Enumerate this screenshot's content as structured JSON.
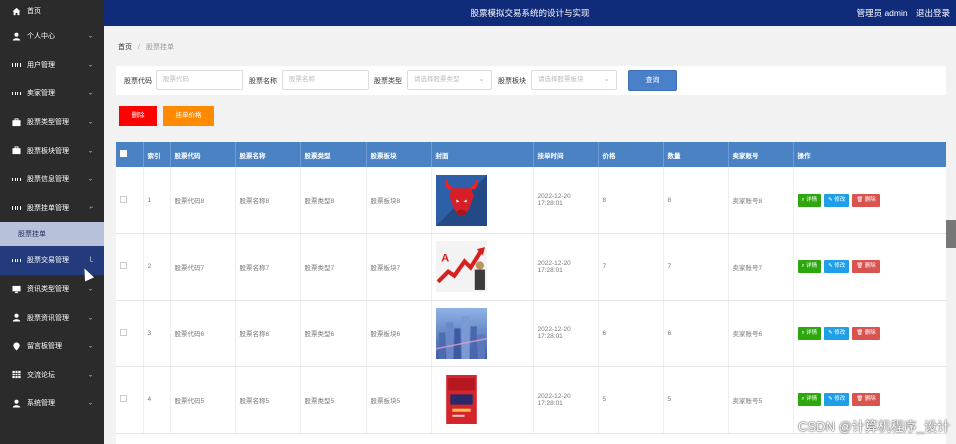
{
  "topbar": {
    "title": "股票模拟交易系统的设计与实现",
    "admin": "管理员 admin",
    "logout": "退出登录"
  },
  "sidebar": {
    "home": "首页",
    "items": [
      {
        "label": "个人中心",
        "icon": "user-icon"
      },
      {
        "label": "用户管理",
        "icon": "grid-icon"
      },
      {
        "label": "卖家管理",
        "icon": "grid-icon"
      },
      {
        "label": "股票类型管理",
        "icon": "briefcase-icon"
      },
      {
        "label": "股票板块管理",
        "icon": "briefcase-icon"
      },
      {
        "label": "股票信息管理",
        "icon": "grid-icon"
      },
      {
        "label": "股票挂单管理",
        "icon": "grid-icon"
      }
    ],
    "sub_item": "股票挂单",
    "current": "股票交易管理",
    "items_after": [
      {
        "label": "资讯类型管理",
        "icon": "monitor-icon"
      },
      {
        "label": "股票资讯管理",
        "icon": "user-icon"
      },
      {
        "label": "留言板管理",
        "icon": "pin-icon"
      },
      {
        "label": "交流论坛",
        "icon": "table-icon"
      },
      {
        "label": "系统管理",
        "icon": "user-icon"
      }
    ]
  },
  "breadcrumb": {
    "home": "首页",
    "current": "股票挂单"
  },
  "search": {
    "code_label": "股票代码",
    "code_placeholder": "股票代码",
    "name_label": "股票名称",
    "name_placeholder": "股票名称",
    "type_label": "股票类型",
    "type_placeholder": "请选择股票类型",
    "sector_label": "股票板块",
    "sector_placeholder": "请选择股票板块",
    "query_button": "查询"
  },
  "actions": {
    "delete": "删除",
    "price": "挂单价格"
  },
  "table": {
    "headers": [
      "索引",
      "股票代码",
      "股票名称",
      "股票类型",
      "股票板块",
      "封面",
      "挂单时间",
      "价格",
      "数量",
      "卖家账号",
      "操作"
    ],
    "op_detail": "详情",
    "op_edit": "修改",
    "op_delete": "删除",
    "rows": [
      {
        "index": "1",
        "code": "股票代码8",
        "name": "股票名称8",
        "type": "股票类型8",
        "sector": "股票板块8",
        "time": "2022-12-20 17:28:01",
        "price": "8",
        "qty": "8",
        "seller": "卖家账号8"
      },
      {
        "index": "2",
        "code": "股票代码7",
        "name": "股票名称7",
        "type": "股票类型7",
        "sector": "股票板块7",
        "time": "2022-12-20 17:28:01",
        "price": "7",
        "qty": "7",
        "seller": "卖家账号7"
      },
      {
        "index": "3",
        "code": "股票代码6",
        "name": "股票名称6",
        "type": "股票类型6",
        "sector": "股票板块6",
        "time": "2022-12-20 17:28:01",
        "price": "6",
        "qty": "6",
        "seller": "卖家账号6"
      },
      {
        "index": "4",
        "code": "股票代码5",
        "name": "股票名称5",
        "type": "股票类型5",
        "sector": "股票板块5",
        "time": "2022-12-20 17:28:01",
        "price": "5",
        "qty": "5",
        "seller": "卖家账号5"
      }
    ]
  },
  "watermark": "CSDN @计算机程序_设计"
}
